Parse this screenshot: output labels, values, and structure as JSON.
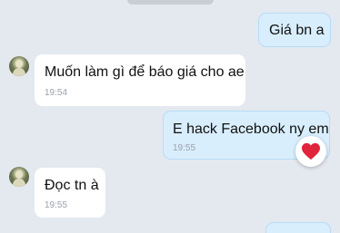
{
  "messages": [
    {
      "text": "Giá bn a",
      "time": ""
    },
    {
      "text": "Muốn làm gì để báo giá cho ae",
      "time": "19:54"
    },
    {
      "text": "E hack Facebook ny em",
      "time": "19:55",
      "reaction": "heart-icon"
    },
    {
      "text": "Đọc tn à",
      "time": "19:55"
    }
  ],
  "colors": {
    "background": "#e4e8ef",
    "outgoing_bubble": "#d9eefd",
    "incoming_bubble": "#ffffff",
    "reaction_heart": "#e0243c"
  }
}
